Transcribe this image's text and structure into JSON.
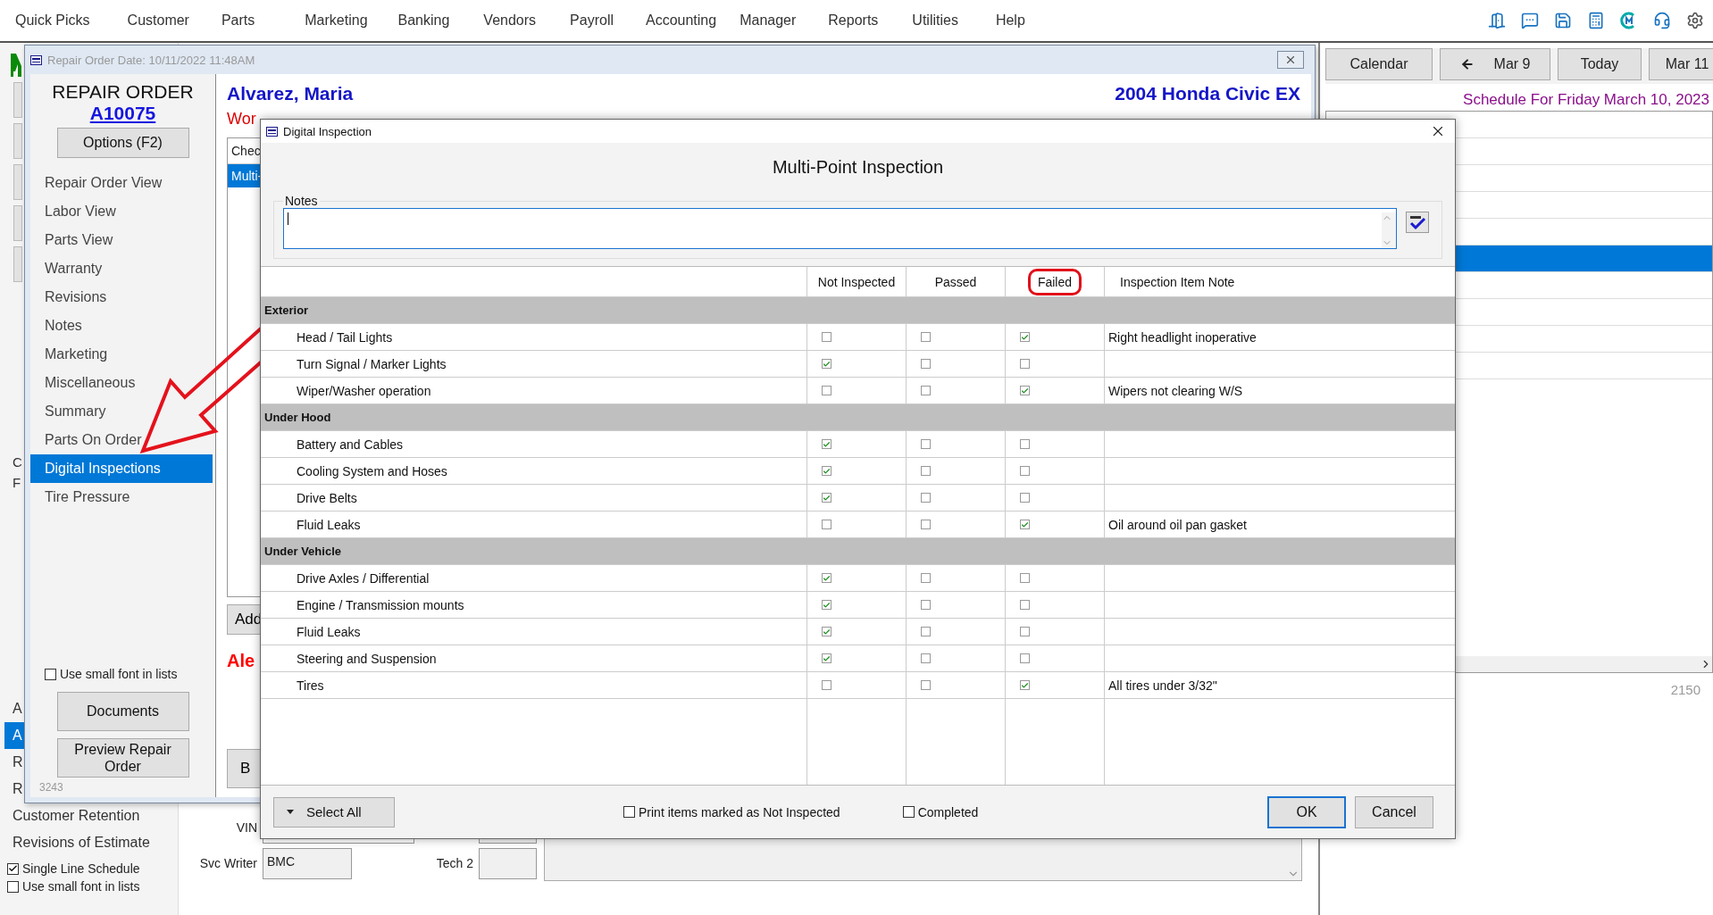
{
  "menu": [
    "Quick Picks",
    "Customer",
    "Parts",
    "Marketing",
    "Banking",
    "Vendors",
    "Payroll",
    "Accounting",
    "Manager",
    "Reports",
    "Utilities",
    "Help"
  ],
  "background": {
    "left_fragments": [
      "C",
      "F"
    ],
    "left_items": [
      {
        "label": "A",
        "selected": false
      },
      {
        "label": "A",
        "selected": true
      },
      {
        "label": "R",
        "selected": false
      },
      {
        "label": "R",
        "selected": false
      },
      {
        "label": "Customer Retention",
        "selected": false
      },
      {
        "label": "Revisions of Estimate",
        "selected": false
      }
    ],
    "checkboxes": [
      {
        "label": "Single Line Schedule",
        "checked": true
      },
      {
        "label": "Use small font in lists",
        "checked": false
      }
    ],
    "form": {
      "vin_label": "VIN",
      "svc_writer_label": "Svc Writer",
      "svc_writer": "BMC",
      "tech2_label": "Tech 2"
    }
  },
  "calendar": {
    "buttons": [
      {
        "label": "Calendar",
        "kind": "plain"
      },
      {
        "label": "Mar 9",
        "kind": "prev"
      },
      {
        "label": "Today",
        "kind": "plain"
      },
      {
        "label": "Mar 11",
        "kind": "next"
      }
    ],
    "heading": "Schedule For Friday  March 10, 2023",
    "rows": [
      {
        "selected": false
      },
      {
        "selected": false
      },
      {
        "selected": false
      },
      {
        "selected": false
      },
      {
        "selected": false
      },
      {
        "selected": true
      },
      {
        "selected": false
      },
      {
        "selected": false
      },
      {
        "selected": false
      },
      {
        "selected": false
      }
    ],
    "count": "2150"
  },
  "repair_order": {
    "title": "Repair Order Date: 10/11/2022  11:48AM",
    "heading": "REPAIR ORDER",
    "number": "A10075",
    "options_button": "Options (F2)",
    "nav": [
      {
        "label": "Repair Order View",
        "selected": false
      },
      {
        "label": "Labor View",
        "selected": false
      },
      {
        "label": "Parts View",
        "selected": false
      },
      {
        "label": "Warranty",
        "selected": false
      },
      {
        "label": "Revisions",
        "selected": false
      },
      {
        "label": "Notes",
        "selected": false
      },
      {
        "label": "Marketing",
        "selected": false
      },
      {
        "label": "Miscellaneous",
        "selected": false
      },
      {
        "label": "Summary",
        "selected": false
      },
      {
        "label": "Parts On Order",
        "selected": false
      },
      {
        "label": "Digital Inspections",
        "selected": true
      },
      {
        "label": "Tire Pressure",
        "selected": false
      }
    ],
    "small_font": {
      "label": "Use small font in lists",
      "checked": false
    },
    "buttons": [
      "Documents",
      "Preview Repair Order"
    ],
    "footer": "3243",
    "customer": "Alvarez, Maria",
    "vehicle": "2004 Honda  Civic EX",
    "status_fragment": "Wor",
    "list_header_fragment": "Chec",
    "list_row_fragment": "Multi-",
    "add_button_fragment": "Add",
    "alert_fragment": "Ale",
    "bottom_button_fragment": "B"
  },
  "dialog": {
    "title": "Digital Inspection",
    "heading": "Multi-Point Inspection",
    "notes_label": "Notes",
    "columns": [
      {
        "label": "Not Inspected",
        "highlighted": false
      },
      {
        "label": "Passed",
        "highlighted": false
      },
      {
        "label": "Failed",
        "highlighted": true
      },
      {
        "label": "Inspection Item Note",
        "highlighted": false
      }
    ],
    "sections": [
      {
        "name": "Exterior",
        "items": [
          {
            "name": "Head / Tail Lights",
            "not_inspected": false,
            "passed": false,
            "failed": true,
            "note": "Right headlight inoperative"
          },
          {
            "name": "Turn Signal / Marker Lights",
            "not_inspected": true,
            "passed": false,
            "failed": false
          },
          {
            "name": "Wiper/Washer operation",
            "not_inspected": false,
            "passed": false,
            "failed": true,
            "note": "Wipers not clearing W/S"
          }
        ]
      },
      {
        "name": "Under Hood",
        "items": [
          {
            "name": "Battery and Cables",
            "not_inspected": true,
            "passed": false,
            "failed": false
          },
          {
            "name": "Cooling System and  Hoses",
            "not_inspected": true,
            "passed": false,
            "failed": false
          },
          {
            "name": "Drive Belts",
            "not_inspected": true,
            "passed": false,
            "failed": false
          },
          {
            "name": "Fluid Leaks",
            "not_inspected": false,
            "passed": false,
            "failed": true,
            "note": "Oil around oil pan gasket"
          }
        ]
      },
      {
        "name": "Under Vehicle",
        "items": [
          {
            "name": "Drive Axles / Differential",
            "not_inspected": true,
            "passed": false,
            "failed": false
          },
          {
            "name": "Engine / Transmission mounts",
            "not_inspected": true,
            "passed": false,
            "failed": false
          },
          {
            "name": "Fluid Leaks",
            "not_inspected": true,
            "passed": false,
            "failed": false
          },
          {
            "name": "Steering and Suspension",
            "not_inspected": true,
            "passed": false,
            "failed": false
          },
          {
            "name": "Tires",
            "not_inspected": false,
            "passed": false,
            "failed": true,
            "note": "All tires under 3/32\""
          }
        ]
      }
    ],
    "select_all": "Select All",
    "options": [
      {
        "label": "Print items marked as Not Inspected",
        "checked": false
      },
      {
        "label": "Completed",
        "checked": false
      }
    ],
    "buttons": [
      {
        "label": "OK",
        "default": true
      },
      {
        "label": "Cancel",
        "default": false
      }
    ]
  }
}
